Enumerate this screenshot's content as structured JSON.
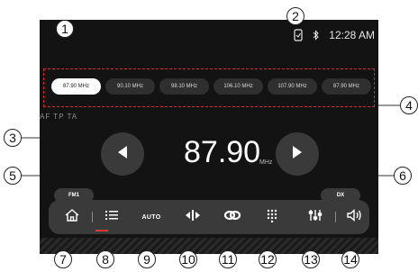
{
  "status": {
    "time": "12:28 AM",
    "phone_icon": "phone-icon",
    "bluetooth_icon": "bluetooth-icon"
  },
  "presets": [
    {
      "label": "87.90 MHz",
      "active": true
    },
    {
      "label": "90.10 MHz",
      "active": false
    },
    {
      "label": "98.10 MHz",
      "active": false
    },
    {
      "label": "106.10 MHz",
      "active": false
    },
    {
      "label": "107.90 MHz",
      "active": false
    },
    {
      "label": "87.90 MHz",
      "active": false
    }
  ],
  "flags": "AF  TP  TA",
  "frequency": "87.90",
  "unit": "MHz",
  "band_label": "FM1",
  "dx_label": "DX",
  "dock": {
    "auto_label": "AUTO"
  },
  "callouts": [
    "1",
    "2",
    "3",
    "4",
    "5",
    "6",
    "7",
    "8",
    "9",
    "10",
    "11",
    "12",
    "13",
    "14"
  ]
}
